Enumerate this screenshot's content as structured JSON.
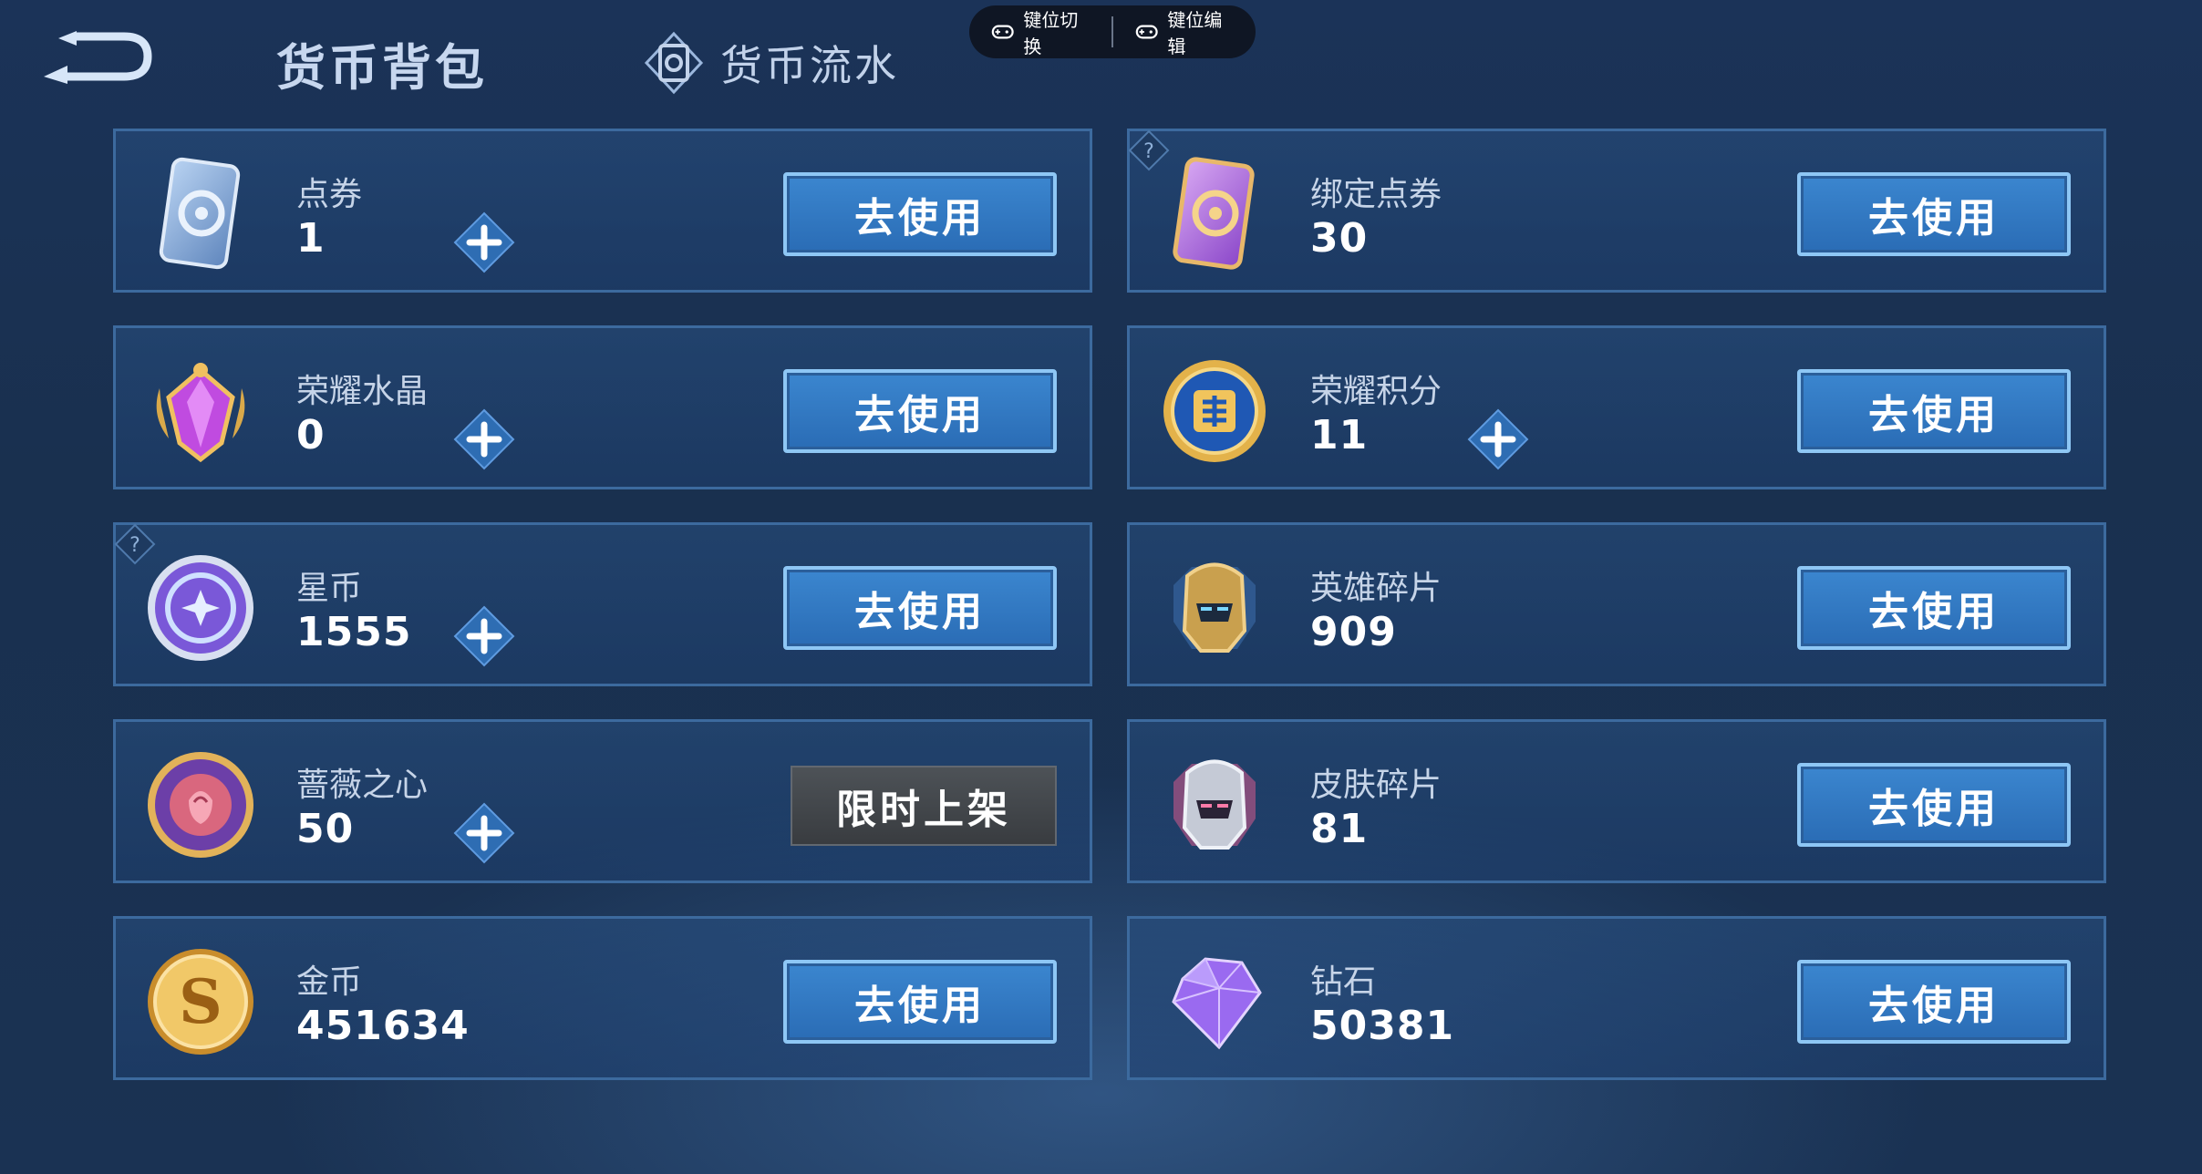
{
  "header": {
    "title": "货币背包",
    "tab_flow": "货币流水"
  },
  "keymap": {
    "switch_label": "键位切换",
    "edit_label": "键位编辑"
  },
  "currencies": [
    {
      "name": "点券",
      "value": "1",
      "action": "去使用"
    },
    {
      "name": "绑定点券",
      "value": "30",
      "action": "去使用"
    },
    {
      "name": "荣耀水晶",
      "value": "0",
      "action": "去使用"
    },
    {
      "name": "荣耀积分",
      "value": "11",
      "action": "去使用"
    },
    {
      "name": "星币",
      "value": "1555",
      "action": "去使用"
    },
    {
      "name": "英雄碎片",
      "value": "909",
      "action": "去使用"
    },
    {
      "name": "蔷薇之心",
      "value": "50",
      "action": "限时上架"
    },
    {
      "name": "皮肤碎片",
      "value": "81",
      "action": "去使用"
    },
    {
      "name": "金币",
      "value": "451634",
      "action": "去使用"
    },
    {
      "name": "钻石",
      "value": "50381",
      "action": "去使用"
    }
  ],
  "icons": {
    "back": "back-arrow-icon",
    "flow": "currency-flow-icon",
    "gamepad": "gamepad-icon",
    "plus": "plus-icon",
    "help": "help-icon"
  },
  "colors": {
    "background": "#1a3253",
    "card_border": "#3c6a9e",
    "button_blue": "#2f78c2",
    "button_border": "#8ec7f5",
    "limited_button": "#44484d"
  }
}
